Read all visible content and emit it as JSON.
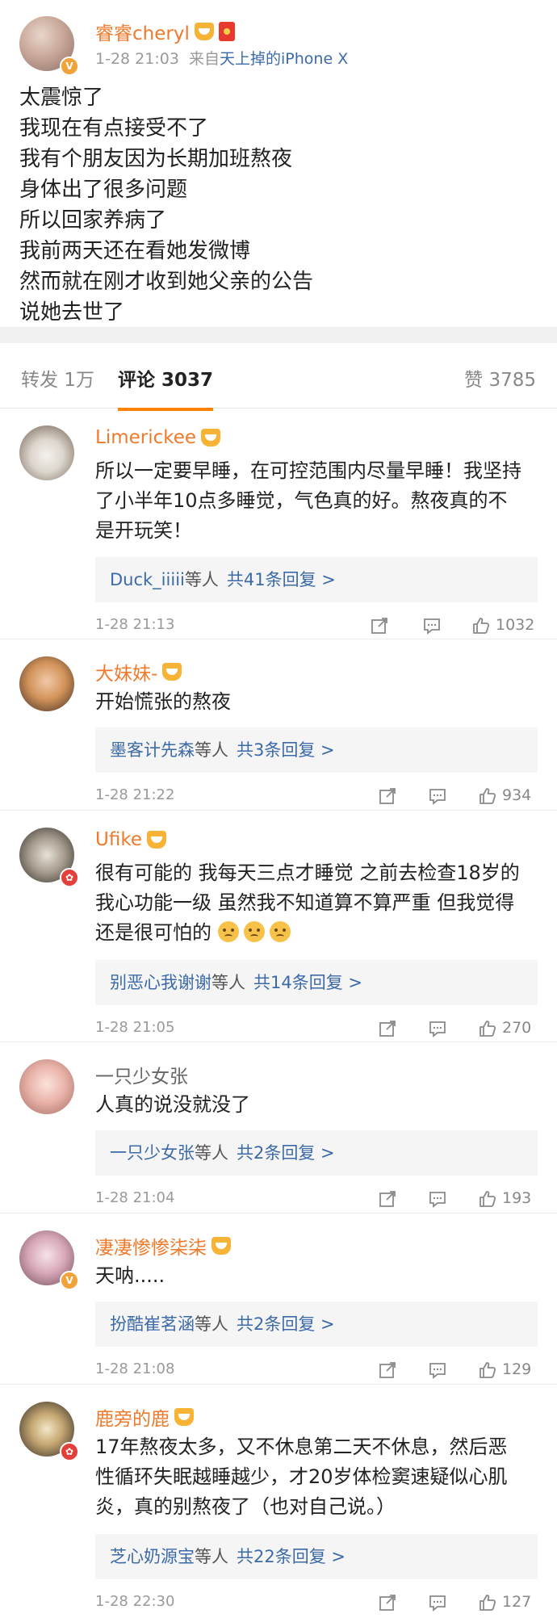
{
  "post": {
    "author": "睿睿cheryl",
    "verified_badge": "V",
    "meta_time": "1-28 21:03",
    "meta_from": "来自",
    "meta_source": "天上掉的iPhone X",
    "lines": [
      "太震惊了",
      "我现在有点接受不了",
      "我有个朋友因为长期加班熬夜",
      "身体出了很多问题",
      "所以回家养病了",
      "我前两天还在看她发微博",
      "然而就在刚才收到她父亲的公告",
      "说她去世了"
    ]
  },
  "tabs": {
    "repost": "转发 1万",
    "comments": "评论 3037",
    "likes": "赞 3785"
  },
  "comments": [
    {
      "name": "Limerickee",
      "lines": [
        "所以一定要早睡，在可控范围内尽量早睡！我坚持",
        "了小半年10点多睡觉，气色真的好。熬夜真的不",
        "是开玩笑！"
      ],
      "reply_who": "Duck_iiiii",
      "reply_mid": "等人",
      "reply_count": "共41条回复 >",
      "time": "1-28 21:13",
      "likes": "1032"
    },
    {
      "name": "大妹妹-",
      "lines": [
        "开始慌张的熬夜"
      ],
      "reply_who": "墨客计先森",
      "reply_mid": "等人",
      "reply_count": "共3条回复 >",
      "time": "1-28 21:22",
      "likes": "934"
    },
    {
      "name": "Ufike",
      "lines": [
        "很有可能的 我每天三点才睡觉 之前去检查18岁的",
        "我心功能一级 虽然我不知道算不算严重 但我觉得",
        "还是很可怕的"
      ],
      "reply_who": "别恶心我谢谢",
      "reply_mid": "等人",
      "reply_count": "共14条回复 >",
      "time": "1-28 21:05",
      "likes": "270"
    },
    {
      "name": "一只少女张",
      "lines": [
        "人真的说没就没了"
      ],
      "reply_who": "一只少女张",
      "reply_mid": "等人",
      "reply_count": "共2条回复 >",
      "time": "1-28 21:04",
      "likes": "193"
    },
    {
      "name": "凄凄惨惨柒柒",
      "lines": [
        "天呐....."
      ],
      "reply_who": "扮酷崔茗涵",
      "reply_mid": "等人",
      "reply_count": "共2条回复 >",
      "time": "1-28 21:08",
      "likes": "129"
    },
    {
      "name": "鹿旁的鹿",
      "lines": [
        "17年熬夜太多，又不休息第二天不休息，然后恶",
        "性循环失眠越睡越少，才20岁体检窦速疑似心肌",
        "炎，真的别熬夜了（也对自己说。）"
      ],
      "reply_who": "芝心奶源宝",
      "reply_mid": "等人",
      "reply_count": "共22条回复 >",
      "time": "1-28 22:30",
      "likes": "127"
    }
  ]
}
